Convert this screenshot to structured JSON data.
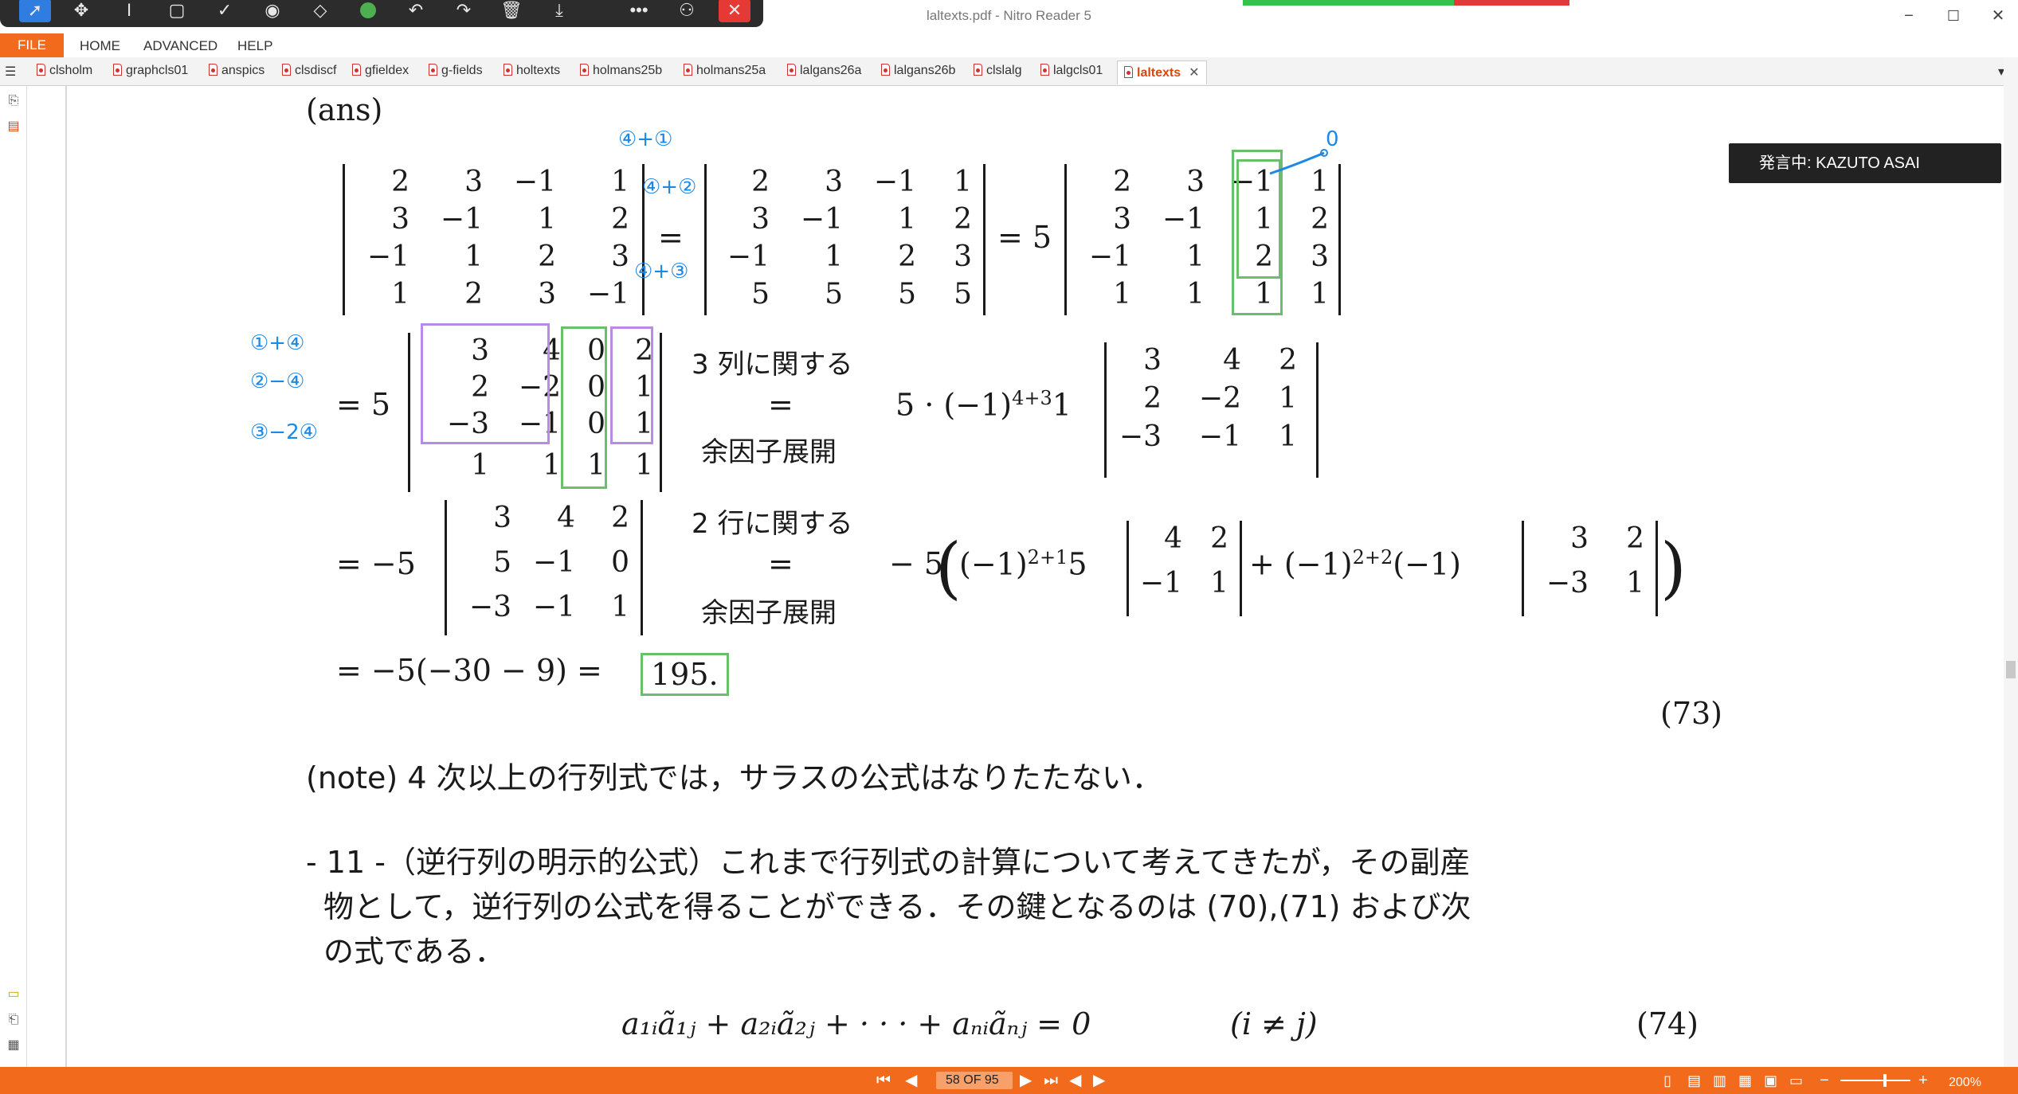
{
  "app": {
    "title": "laltexts.pdf - Nitro Reader 5",
    "window_controls": [
      "minimize-icon",
      "maximize-icon",
      "close-icon"
    ]
  },
  "ribbon": {
    "file": "FILE",
    "tabs": [
      "HOME",
      "ADVANCED",
      "HELP"
    ]
  },
  "doc_tabs": [
    "clsholm",
    "graphcls01",
    "anspics",
    "clsdiscf",
    "gfieldex",
    "g-fields",
    "holtexts",
    "holmans25b",
    "holmans25a",
    "lalgans26a",
    "lalgans26b",
    "clslalg",
    "lalgcls01",
    "laltexts"
  ],
  "active_tab": "laltexts",
  "speaking": "発言中: KAZUTO ASAI",
  "status": {
    "page_indicator": "58 OF 95",
    "zoom": "200%"
  },
  "doc": {
    "ans": "(ans)",
    "m1": [
      [
        "2",
        "3",
        "−1",
        "1"
      ],
      [
        "3",
        "−1",
        "1",
        "2"
      ],
      [
        "−1",
        "1",
        "2",
        "3"
      ],
      [
        "1",
        "2",
        "3",
        "−1"
      ]
    ],
    "eq": "=",
    "m2": [
      [
        "2",
        "3",
        "−1",
        "1"
      ],
      [
        "3",
        "−1",
        "1",
        "2"
      ],
      [
        "−1",
        "1",
        "2",
        "3"
      ],
      [
        "5",
        "5",
        "5",
        "5"
      ]
    ],
    "eq5": "= 5",
    "m3": [
      [
        "2",
        "3",
        "−1",
        "1"
      ],
      [
        "3",
        "−1",
        "1",
        "2"
      ],
      [
        "−1",
        "1",
        "2",
        "3"
      ],
      [
        "1",
        "1",
        "1",
        "1"
      ]
    ],
    "eq5b": "= 5",
    "m4": [
      [
        "3",
        "4",
        "0",
        "2"
      ],
      [
        "2",
        "−2",
        "0",
        "1"
      ],
      [
        "−3",
        "−1",
        "0",
        "1"
      ],
      [
        "1",
        "1",
        "1",
        "1"
      ]
    ],
    "expand_col": "3 列に関する",
    "expand_eq": "=",
    "expand_word": "余因子展開",
    "coef1": "5 · (−1)",
    "coef1_exp": "4+3",
    "coef1_tail": "1",
    "m5": [
      [
        "3",
        "4",
        "2"
      ],
      [
        "2",
        "−2",
        "1"
      ],
      [
        "−3",
        "−1",
        "1"
      ]
    ],
    "eqm5": "= −5",
    "m6": [
      [
        "3",
        "4",
        "2"
      ],
      [
        "5",
        "−1",
        "0"
      ],
      [
        "−3",
        "−1",
        "1"
      ]
    ],
    "expand_row": "2 行に関する",
    "coef2": "− 5",
    "term1": "(−1)",
    "term1_exp": "2+1",
    "term1_tail": "5",
    "m7": [
      [
        "4",
        "2"
      ],
      [
        "−1",
        "1"
      ]
    ],
    "term2": "+ (−1)",
    "term2_exp": "2+2",
    "term2_tail": "(−1)",
    "m8": [
      [
        "3",
        "2"
      ],
      [
        "−3",
        "1"
      ]
    ],
    "final": "= −5(−30 − 9) =",
    "result": "195.",
    "eqnum73": "(73)",
    "note": "(note)  4 次以上の行列式では，サラスの公式はなりたたない．",
    "sec_line1": "- 11 -（逆行列の明示的公式）これまで行列式の計算について考えてきたが，その副産",
    "sec_line2": "物として，逆行列の公式を得ることができる．その鍵となるのは (70),(71) および次",
    "sec_line3": "の式である．",
    "formula74": "a₁ᵢã₁ⱼ + a₂ᵢã₂ⱼ + · · · + aₙᵢãₙⱼ = 0",
    "cond74": "(i ≠ j)",
    "eqnum74": "(74)"
  },
  "handwriting": {
    "h1": "④+①",
    "h2": "④+②",
    "h3": "④+③",
    "h4": "0",
    "h5": "①+④",
    "h6": "②−④",
    "h7": "③−2④"
  },
  "colors": {
    "accent": "#f26b1d",
    "green_box": "#6abf6a",
    "purple_box": "#b98ae6",
    "ink_blue": "#1e88e5"
  }
}
